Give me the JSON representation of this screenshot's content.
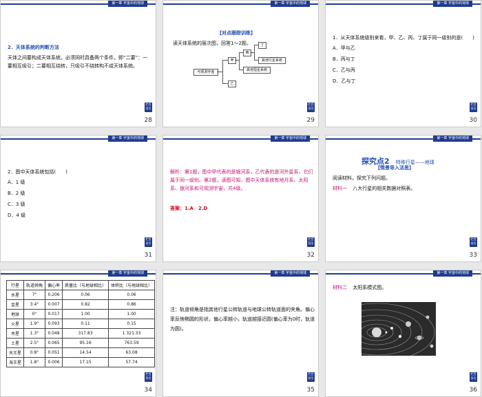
{
  "header_tag": "第一章 宇宙中的地球",
  "back_label": "栏目导引",
  "slides": [
    {
      "num": "28",
      "title": "2．天体系统的判断方法",
      "body": "天体之间要构成天体系统，必须同时具备两个条件，即“二要”：一要相互吸引；二要相互绕转，只吸引不绕转构不成天体系统。"
    },
    {
      "num": "29",
      "title": "【对点跟踪训练】",
      "intro": "读天体系统的层次图，回答1～2题。",
      "diagram": {
        "root": "可观测宇宙",
        "b1": "甲",
        "b2": "乙",
        "c1": "西",
        "c2": "其他恒星系统",
        "d1": "丁",
        "d2": "其他行星系统"
      }
    },
    {
      "num": "30",
      "question": "1．从天体系统级别来看，甲、乙、丙、丁属于同一级别的是(　　)",
      "options": [
        "A．甲与乙",
        "B．丙与丁",
        "C．乙与丙",
        "D．乙与丁"
      ]
    },
    {
      "num": "31",
      "question": "2．图中天体系统包括(　　)",
      "options": [
        "A．1 级",
        "B．2 级",
        "C．3 级",
        "D．4 级"
      ]
    },
    {
      "num": "32",
      "explain": "解析：第1题，图中甲代表的是银河系，乙代表的是河外星系，它们属于同一级别。第2题，读图可知，图中天体系统有地月系、太阳系、银河系和可观测宇宙，共4级。",
      "answer": "答案：1.A　2.D"
    },
    {
      "num": "33",
      "title": "探究点2",
      "subtitle": "特殊行星——地球",
      "tag": "【情景导入活思】",
      "line1": "阅读材料，探究下列问题。",
      "material_label": "材料一",
      "material_text": "八大行星的相关数据对照表。"
    },
    {
      "num": "34",
      "table": {
        "headers": [
          "行星",
          "轨道倾角",
          "偏心率",
          "质量比（与地球相比）",
          "体积比（与地球相比）"
        ],
        "rows": [
          [
            "水星",
            "7°",
            "0.206",
            "0.06",
            "0.06"
          ],
          [
            "金星",
            "3.4°",
            "0.007",
            "0.82",
            "0.86"
          ],
          [
            "地球",
            "0°",
            "0.017",
            "1.00",
            "1.00"
          ],
          [
            "火星",
            "1.9°",
            "0.093",
            "0.11",
            "0.15"
          ],
          [
            "木星",
            "1.3°",
            "0.048",
            "317.83",
            "1 321.33"
          ],
          [
            "土星",
            "2.5°",
            "0.065",
            "95.16",
            "763.59"
          ],
          [
            "天王星",
            "0.8°",
            "0.051",
            "14.54",
            "63.08"
          ],
          [
            "海王星",
            "1.8°",
            "0.006",
            "17.15",
            "57.74"
          ]
        ]
      }
    },
    {
      "num": "35",
      "note": "注：轨道倾角是指其他行星公转轨道与地球公转轨道面的夹角。偏心率反映椭圆的形状，偏心率越小，轨道越接近圆(偏心率为0时，轨道为圆)。"
    },
    {
      "num": "36",
      "material_label": "材料二",
      "material_text": "太阳系模式图。"
    }
  ]
}
